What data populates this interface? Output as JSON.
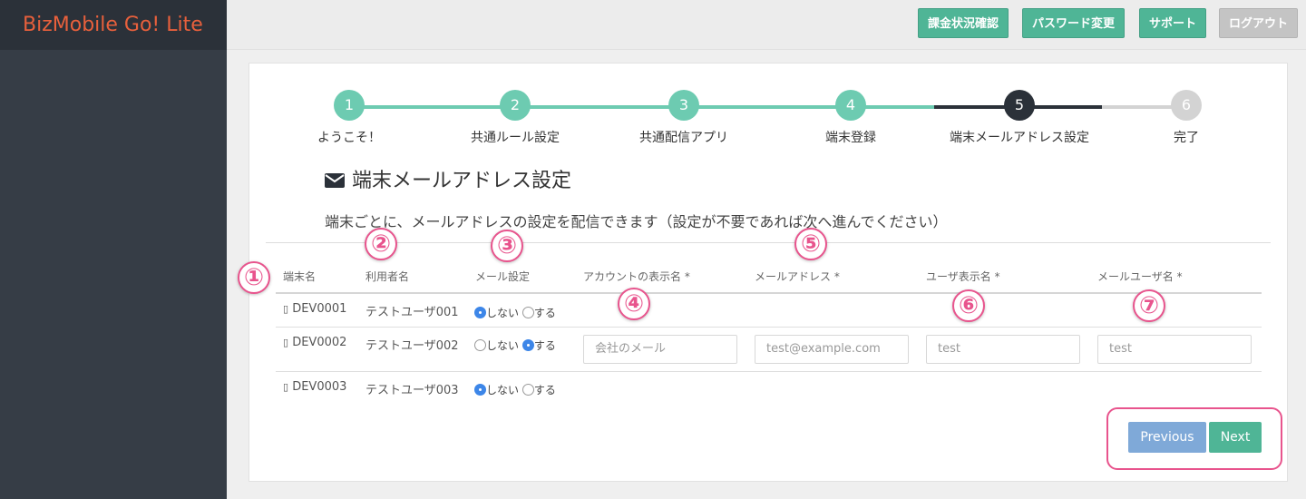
{
  "brand": "BizMobile Go! Lite",
  "topbar": {
    "billing": "課金状況確認",
    "password": "パスワード変更",
    "support": "サポート",
    "logout": "ログアウト"
  },
  "steps": [
    {
      "num": "1",
      "label": "ようこそ！",
      "state": "done"
    },
    {
      "num": "2",
      "label": "共通ルール設定",
      "state": "done"
    },
    {
      "num": "3",
      "label": "共通配信アプリ",
      "state": "done"
    },
    {
      "num": "4",
      "label": "端末登録",
      "state": "done"
    },
    {
      "num": "5",
      "label": "端末メールアドレス設定",
      "state": "current"
    },
    {
      "num": "6",
      "label": "完了",
      "state": "todo"
    }
  ],
  "colors": {
    "done": "#6dcbb1",
    "current": "#2b3139",
    "todo": "#d3d3d3",
    "accent": "#4fb596",
    "marker": "#e8548d"
  },
  "section": {
    "title": "端末メールアドレス設定",
    "icon": "envelope-icon",
    "description": "端末ごとに、メールアドレスの設定を配信できます（設定が不要であれば次へ進んでください）"
  },
  "table": {
    "headers": {
      "device": "端末名",
      "user": "利用者名",
      "mail": "メール設定",
      "account": "アカウントの表示名 *",
      "address": "メールアドレス *",
      "display": "ユーザ表示名 *",
      "mailuser": "メールユーザ名 *"
    },
    "radio_off": "しない",
    "radio_on": "する",
    "rows": [
      {
        "device": "DEV0001",
        "user": "テストユーザ001",
        "mail_enabled": false
      },
      {
        "device": "DEV0002",
        "user": "テストユーザ002",
        "mail_enabled": true,
        "account_placeholder": "会社のメール",
        "address_placeholder": "test@example.com",
        "display_placeholder": "test",
        "mailuser_placeholder": "test"
      },
      {
        "device": "DEV0003",
        "user": "テストユーザ003",
        "mail_enabled": false
      }
    ]
  },
  "markers": [
    "①",
    "②",
    "③",
    "④",
    "⑤",
    "⑥",
    "⑦"
  ],
  "nav": {
    "previous": "Previous",
    "next": "Next"
  }
}
